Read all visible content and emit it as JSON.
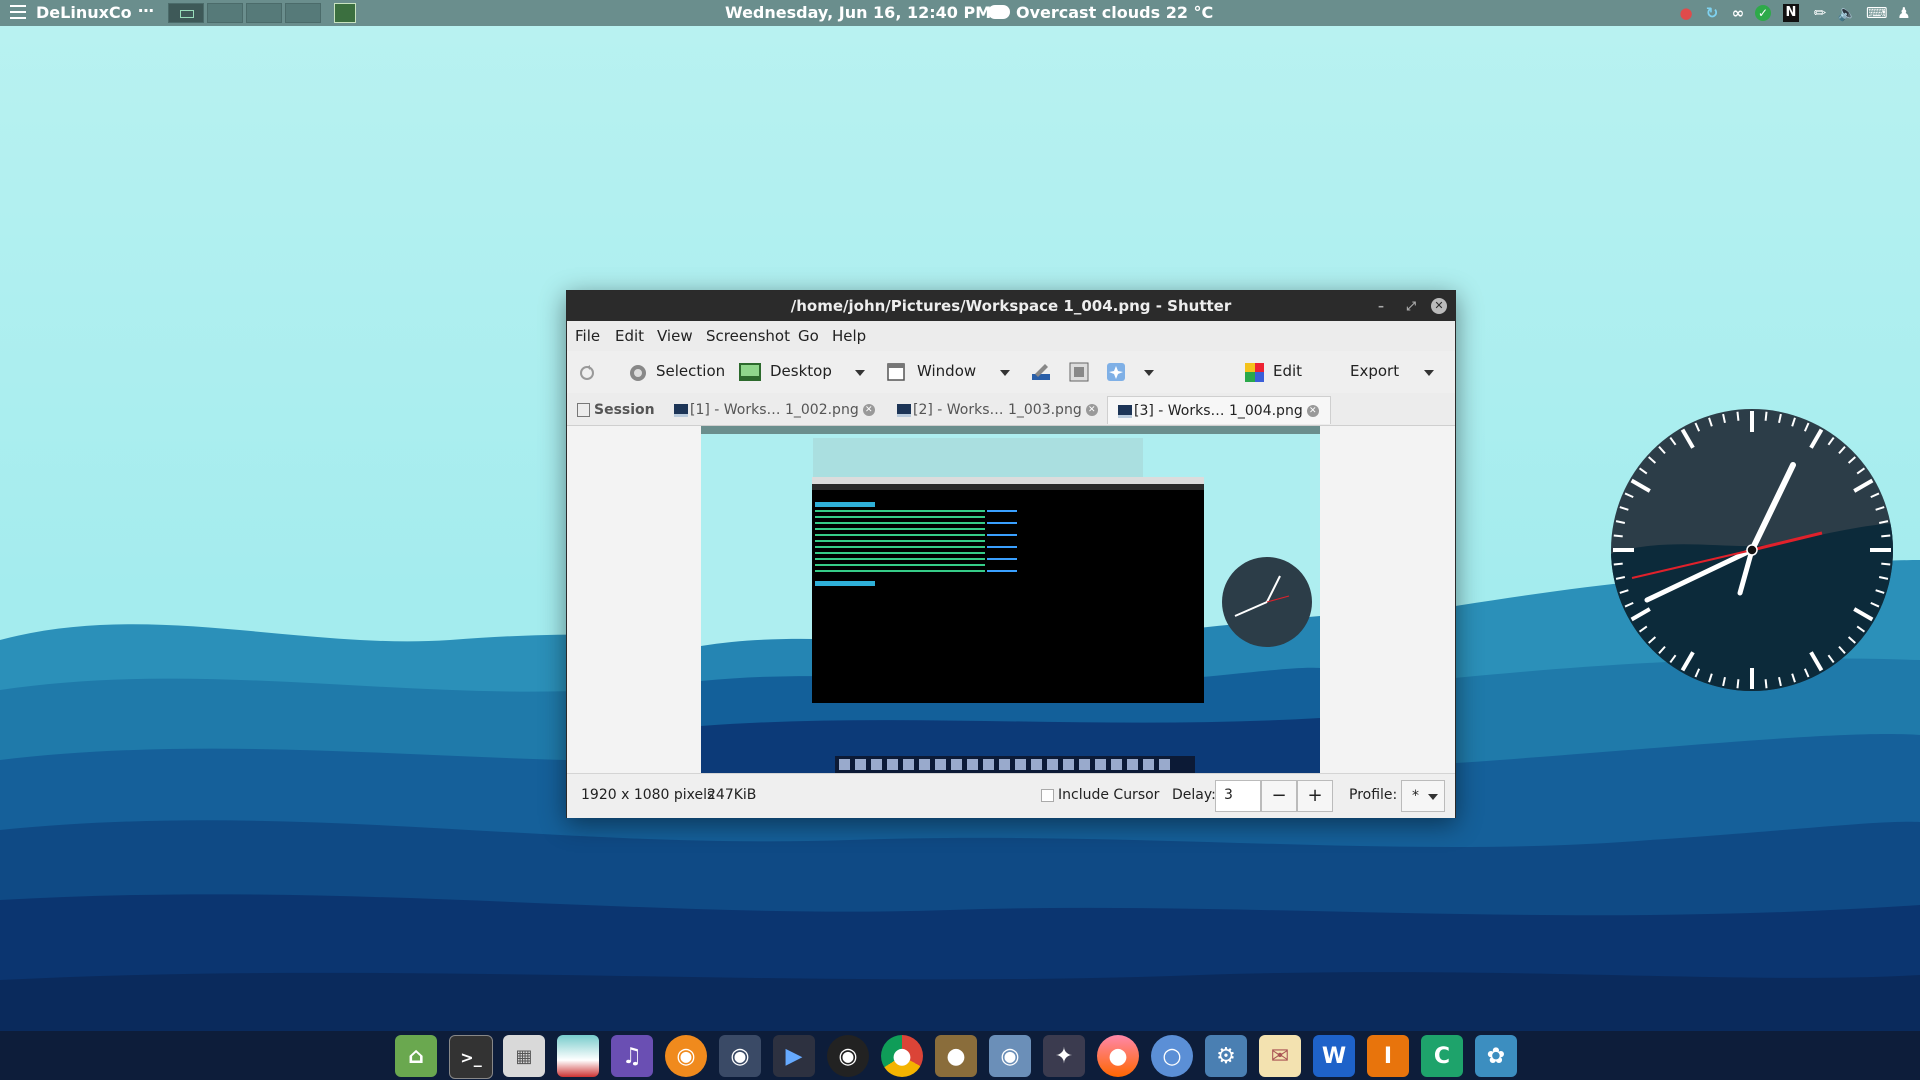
{
  "top_panel": {
    "brand": "DeLinuxCo",
    "dots": "⋯",
    "datetime": "Wednesday, Jun 16, 12:40 PM",
    "weather": "Overcast clouds 22 °C"
  },
  "window": {
    "title": "/home/john/Pictures/Workspace 1_004.png - Shutter",
    "menu": [
      "File",
      "Edit",
      "View",
      "Screenshot",
      "Go",
      "Help"
    ],
    "toolbar": {
      "selection": "Selection",
      "desktop": "Desktop",
      "window": "Window",
      "edit": "Edit",
      "export": "Export"
    },
    "tabs": {
      "session": "Session",
      "items": [
        {
          "label": "[1] - Works… 1_002.png"
        },
        {
          "label": "[2] - Works… 1_003.png"
        },
        {
          "label": "[3] - Works… 1_004.png"
        }
      ]
    },
    "status": {
      "dimensions": "1920 x 1080 pixels",
      "size": "247KiB",
      "include_cursor": "Include Cursor",
      "delay_label": "Delay:",
      "delay_value": "3",
      "minus": "−",
      "plus": "+",
      "profile_label": "Profile:",
      "profile_value": "*"
    }
  },
  "dock": {
    "icons": [
      "home-folder-icon",
      "terminal-icon",
      "calculator-icon",
      "image-viewer-icon",
      "audio-player-icon",
      "blender-icon",
      "screen-recorder-icon",
      "video-editor-icon",
      "camera-icon",
      "chrome-icon",
      "gimp-icon",
      "network-manager-icon",
      "inkscape-icon",
      "firefox-icon",
      "chromium-icon",
      "screenshot-tool-icon",
      "stamp-icon",
      "word-icon",
      "impress-icon",
      "calc-icon",
      "shutter-icon"
    ],
    "letters": {
      "word": "W",
      "impress": "I",
      "calc": "C"
    }
  },
  "colors": {
    "panel": "#6a8e8d",
    "sky_top": "#b8f0f0",
    "dock": "#0d1d3a"
  }
}
